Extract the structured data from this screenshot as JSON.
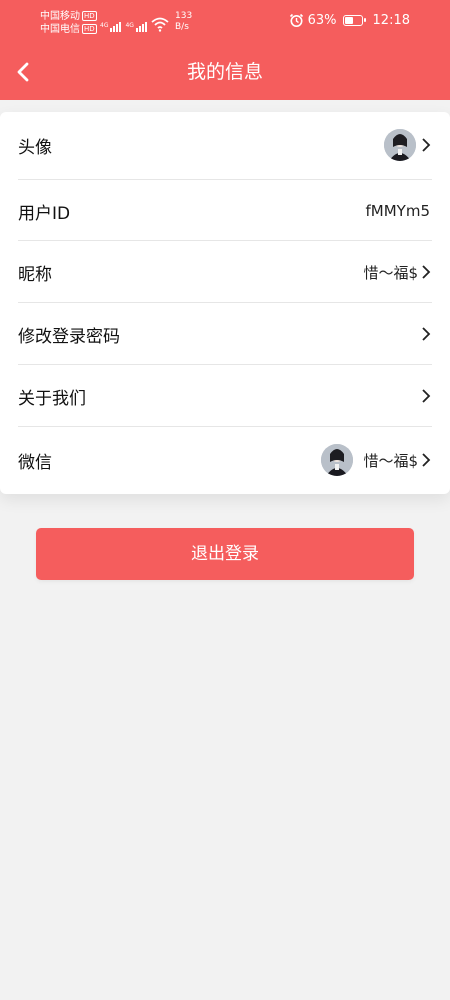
{
  "status_bar": {
    "carrier1": "中国移动",
    "carrier2": "中国电信",
    "hd_badge": "HD",
    "net_type1": "4G",
    "net_type2": "4G",
    "net_speed_value": "133",
    "net_speed_unit": "B/s",
    "battery_percent": "63%",
    "battery_level": 0.63,
    "time": "12:18",
    "icons": [
      "signal-icon",
      "wifi-icon",
      "alarm-icon",
      "battery-icon"
    ]
  },
  "header": {
    "title": "我的信息",
    "back_icon": "chevron-left-icon",
    "background": "#f55d5d"
  },
  "profile": {
    "rows": [
      {
        "label": "头像",
        "value": ""
      },
      {
        "label": "用户ID",
        "value": "fMMYm5"
      },
      {
        "label": "昵称",
        "value": "惜～福$"
      },
      {
        "label": "修改登录密码",
        "value": ""
      },
      {
        "label": "关于我们",
        "value": ""
      },
      {
        "label": "微信",
        "value": "惜～福$"
      }
    ]
  },
  "logout": {
    "label": "退出登录",
    "color": "#f55d5d"
  }
}
